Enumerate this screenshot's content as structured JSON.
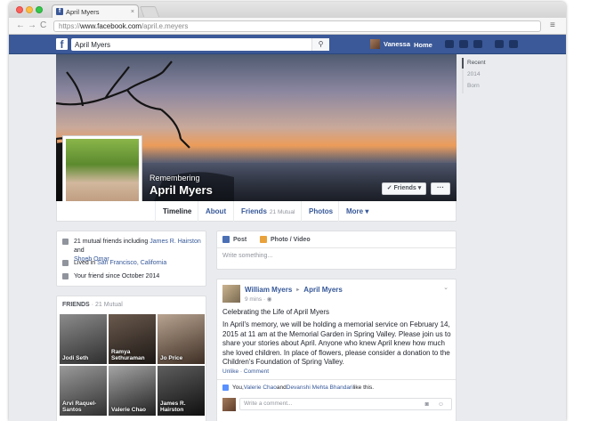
{
  "browser": {
    "tab_title": "April Myers",
    "tab_close": "×",
    "url_proto": "https://",
    "url_host": "www.facebook.com",
    "url_path": "/april.e.meyers",
    "back": "←",
    "forward": "→",
    "reload": "C",
    "menu": "≡"
  },
  "fbbar": {
    "logo": "f",
    "search_value": "April Myers",
    "search_icon": "⚲",
    "user_name": "Vanessa",
    "home_label": "Home"
  },
  "profile": {
    "remembering": "Remembering",
    "name": "April Myers",
    "friends_button": "✓ Friends ▾",
    "more_button": "···"
  },
  "nav": {
    "tabs": [
      {
        "label": "Timeline"
      },
      {
        "label": "About"
      },
      {
        "label": "Friends",
        "count": "21 Mutual"
      },
      {
        "label": "Photos"
      },
      {
        "label": "More ▾"
      }
    ]
  },
  "intro": {
    "mutual_prefix": "21 mutual friends including ",
    "mutual_name_1": "James R. Hairston",
    "mutual_and": " and",
    "mutual_name_2": "Shoeb Omar",
    "lived_prefix": "Lived in ",
    "lived_city": "San Francisco, California",
    "friend_since": "Your friend since October 2014"
  },
  "friends": {
    "heading": "FRIENDS",
    "count": "· 21 Mutual",
    "items": [
      {
        "name": "Jodi Seth"
      },
      {
        "name": "Ramya Sethuraman"
      },
      {
        "name": "Jo Price"
      },
      {
        "name": "Arvi Raquel-Santos"
      },
      {
        "name": "Valerie Chao"
      },
      {
        "name": "James R. Hairston"
      }
    ]
  },
  "composer": {
    "post_label": "Post",
    "photo_label": "Photo / Video",
    "placeholder": "Write something..."
  },
  "post": {
    "author": "William Myers",
    "arrow": "▸",
    "target": "April Myers",
    "time": "9 mins · ",
    "chevron": "⌄",
    "title": "Celebrating the Life of April Myers",
    "body": "In April's memory, we will be holding a memorial service on February 14, 2015 at 11 am at the Memorial Garden in Spring Valley. Please join us to share your stories about April. Anyone who knew April knew how much she loved children. In place of flowers, please consider a donation to the Children's Foundation of Spring Valley.",
    "actions": "Unlike · Comment",
    "likes_prefix": "You, ",
    "likes_name_1": "Valerie Chao",
    "likes_and": " and ",
    "likes_name_2": "Devanshi Mehta Bhandari",
    "likes_suffix": " like this.",
    "comment_placeholder": "Write a comment...",
    "comment_icons": "◙ ☺"
  },
  "rail": {
    "items": [
      {
        "label": "Recent"
      },
      {
        "label": "2014"
      },
      {
        "label": "Born"
      }
    ]
  }
}
